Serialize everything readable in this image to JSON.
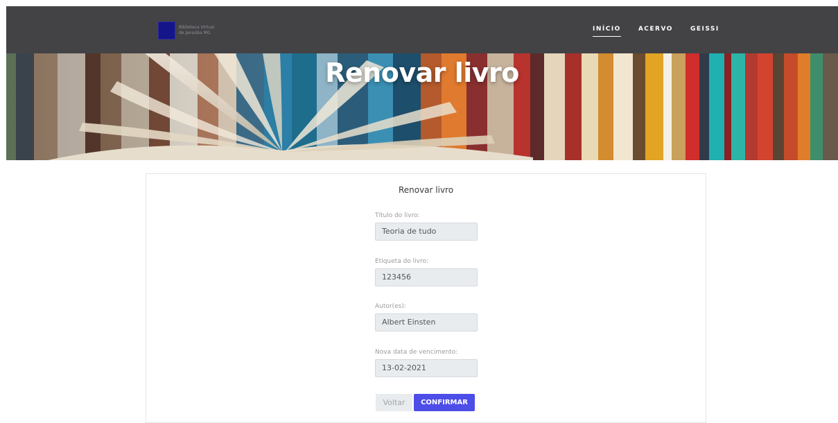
{
  "brand": {
    "name_line1": "Biblioteca Virtual",
    "name_line2": "de Janaúba MG",
    "logo_color": "#15158a"
  },
  "nav": {
    "items": [
      {
        "label": "INÍCIO",
        "active": true
      },
      {
        "label": "ACERVO",
        "active": false
      },
      {
        "label": "GEISSI",
        "active": false
      }
    ]
  },
  "hero": {
    "title": "Renovar livro"
  },
  "form": {
    "title": "Renovar livro",
    "fields": [
      {
        "label": "Título do livro:",
        "value": "Teoria de tudo"
      },
      {
        "label": "Etiqueta do livro:",
        "value": "123456"
      },
      {
        "label": "Autor(es):",
        "value": "Albert Einsten"
      },
      {
        "label": "Nova data de vencimento:",
        "value": "13-02-2021"
      }
    ],
    "back_label": "Voltar",
    "confirm_label": "CONFIRMAR"
  },
  "colors": {
    "navbar": "#434346",
    "primary_button": "#4d4de8",
    "input_background": "#e9ecef"
  }
}
